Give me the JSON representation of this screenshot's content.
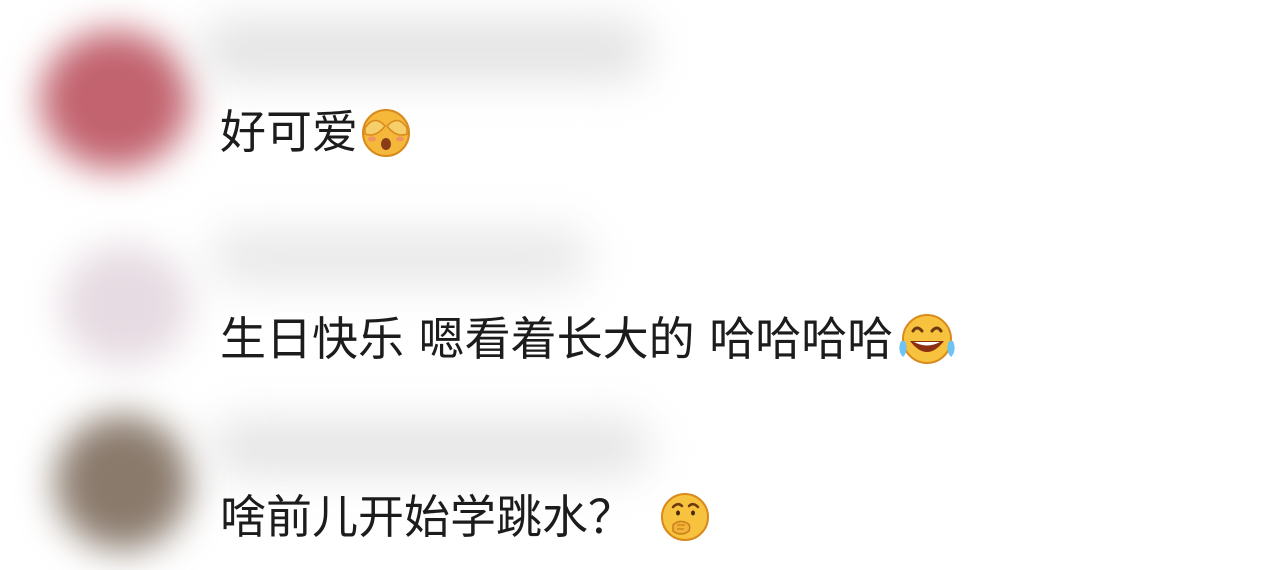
{
  "comments": [
    {
      "text": "好可爱",
      "emoji": "face-covering-eyes-emoji",
      "avatar_color": "#c2636f"
    },
    {
      "text": "生日快乐 嗯看着长大的 哈哈哈哈",
      "emoji": "tears-of-joy-emoji",
      "avatar_color": "#e6dbe2"
    },
    {
      "text": "啥前儿开始学跳水？ ",
      "emoji": "thinking-hand-on-mouth-emoji",
      "avatar_color": "#8a7a6c"
    }
  ]
}
